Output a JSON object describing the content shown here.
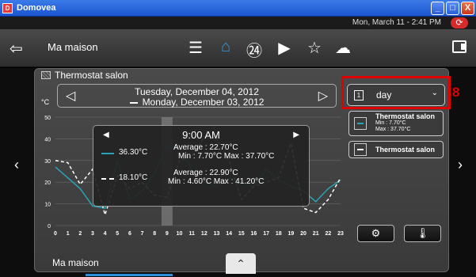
{
  "window": {
    "title": "Domovea",
    "icon_letter": "D",
    "min": "_",
    "max": "□",
    "close": "X"
  },
  "status": {
    "datetime": "Mon, March 11 - 2:41 PM",
    "refresh": "⟳"
  },
  "nav": {
    "back": "⇦",
    "title": "Ma maison",
    "icons": [
      "list-icon",
      "home-icon",
      "timer-24-icon",
      "camera-icon",
      "star-icon",
      "cloud-icon"
    ],
    "glyphs": [
      "☰",
      "⌂",
      "㉔",
      "▶",
      "☆",
      "☁"
    ]
  },
  "panel": {
    "title": "Thermostat salon",
    "date_primary": "Tuesday, December 04, 2012",
    "date_secondary": "Monday, December 03, 2012",
    "unit": "°C",
    "prev": "◁",
    "next": "▷"
  },
  "period": {
    "icon_text": "1",
    "value": "day",
    "chevron": "⌄"
  },
  "annotation": {
    "label": "8"
  },
  "legend": [
    {
      "name": "Thermostat salon",
      "min": "Min : 7.70°C",
      "max": "Max : 37.70°C"
    },
    {
      "name": "Thermostat salon"
    }
  ],
  "tooltip": {
    "time": "9:00 AM",
    "left": "◀",
    "right": "▶",
    "series1": {
      "value": "36.30°C",
      "average": "Average :  22.70°C",
      "minmax": "Min :  7.70°C   Max :   37.70°C"
    },
    "series2": {
      "value": "18.10°C",
      "average": "Average :  22.90°C",
      "minmax": "Min :  4.60°C   Max :  41.20°C"
    }
  },
  "footer": {
    "title": "Ma maison",
    "up": "⌃"
  },
  "side": {
    "left": "‹",
    "right": "›"
  },
  "buttons": {
    "settings": "⚙",
    "thermometer": "🌡"
  },
  "chart_data": {
    "type": "line",
    "x": [
      0,
      1,
      2,
      3,
      4,
      5,
      6,
      7,
      8,
      9,
      10,
      11,
      12,
      13,
      14,
      15,
      16,
      17,
      18,
      19,
      20,
      21,
      22,
      23
    ],
    "yticks": [
      0,
      10,
      20,
      30,
      40,
      50
    ],
    "ylim": [
      0,
      50
    ],
    "highlight_x": 9,
    "series": [
      {
        "name": "Thermostat salon",
        "color": "#2aa3b7",
        "style": "solid",
        "values": [
          27,
          22,
          17,
          9,
          8,
          30,
          12,
          16,
          24,
          37,
          36,
          26,
          20,
          18,
          22,
          20,
          18,
          26,
          21,
          18,
          16,
          11,
          17,
          21
        ]
      },
      {
        "name": "Thermostat salon",
        "color": "#ffffff",
        "style": "dashed",
        "values": [
          30,
          29,
          19,
          26,
          5,
          23,
          17,
          20,
          14,
          13,
          30,
          32,
          41,
          40,
          30,
          12,
          18,
          20,
          22,
          38,
          8,
          6,
          12,
          22
        ]
      }
    ]
  }
}
